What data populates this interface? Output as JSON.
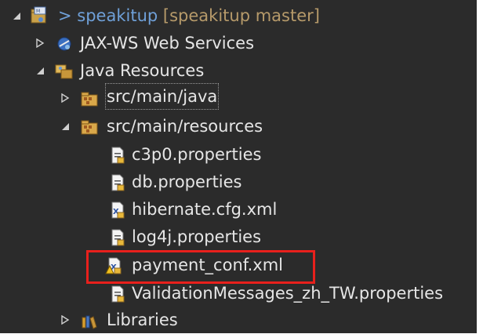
{
  "project": {
    "prefix": "> ",
    "name": "speakitup",
    "branch": "[speakitup master]"
  },
  "tree": {
    "jaxws": "JAX-WS Web Services",
    "java_resources": "Java Resources",
    "src_main_java": "src/main/java",
    "src_main_resources": "src/main/resources",
    "files": [
      "c3p0.properties",
      "db.properties",
      "hibernate.cfg.xml",
      "log4j.properties",
      "payment_conf.xml",
      "ValidationMessages_zh_TW.properties"
    ],
    "libraries": "Libraries"
  },
  "colors": {
    "background": "#2b2b2b",
    "text": "#e6e6e6",
    "project_name": "#6fa0d8",
    "branch": "#b69a6a",
    "highlight_box": "#e8201c"
  }
}
